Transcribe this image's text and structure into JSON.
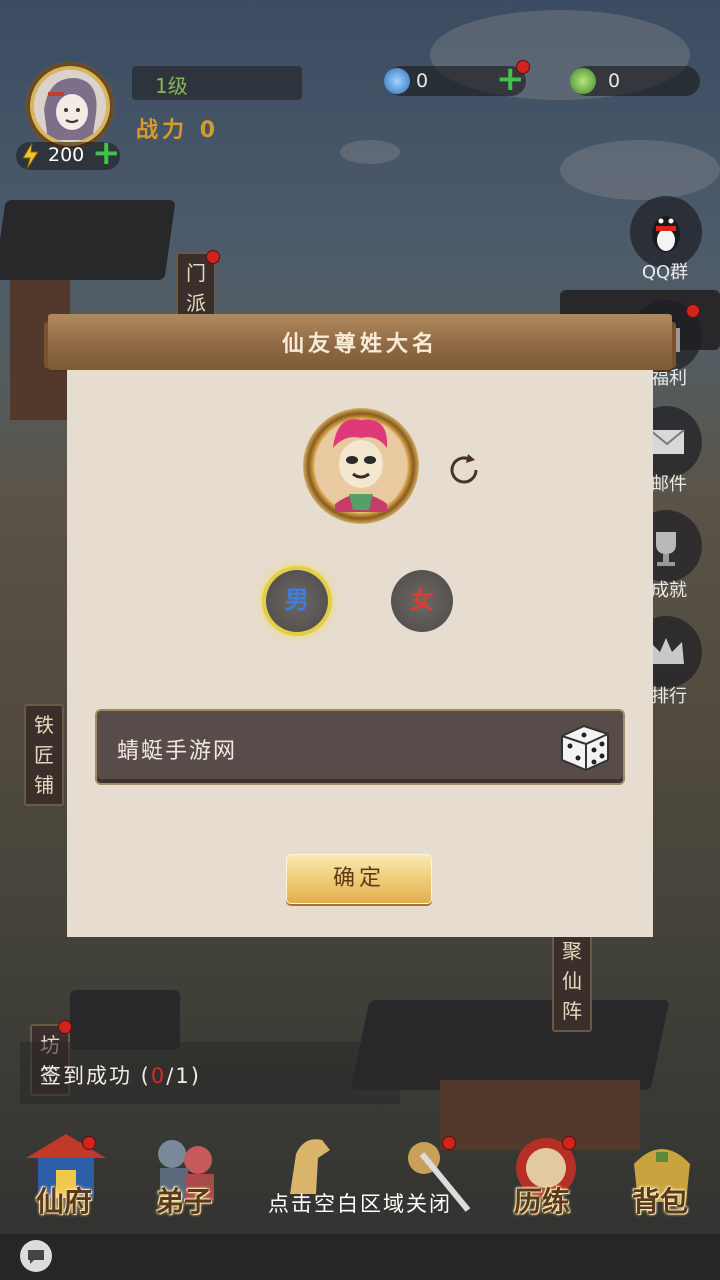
{
  "header": {
    "level": "1级",
    "power_label": "战力",
    "power_value": "0",
    "energy": "200",
    "diamond": "0",
    "jade": "0"
  },
  "side_buttons": {
    "qq": "QQ群",
    "welfare": "福利",
    "mail": "邮件",
    "achievement": "成就",
    "rank": "排行"
  },
  "signs": {
    "sect": "门派",
    "blacksmith": "铁匠铺",
    "gather": "聚仙阵",
    "market": "坊市"
  },
  "modal": {
    "title": "仙友尊姓大名",
    "gender_male": "男",
    "gender_female": "女",
    "name_value": "蜻蜓手游网",
    "confirm": "确定"
  },
  "signin": {
    "label": "签到成功",
    "progress_current": "0",
    "progress_total": "1"
  },
  "close_hint": "点击空白区域关闭",
  "nav": [
    "仙府",
    "弟子",
    "历练",
    "背包"
  ],
  "colors": {
    "modal_header": "#8f6a44",
    "modal_body": "#e6ddd0",
    "confirm_button": "#f1cf7c",
    "selected_glow": "#e2cf46",
    "male": "#3d7ee0",
    "female": "#e03a37"
  }
}
